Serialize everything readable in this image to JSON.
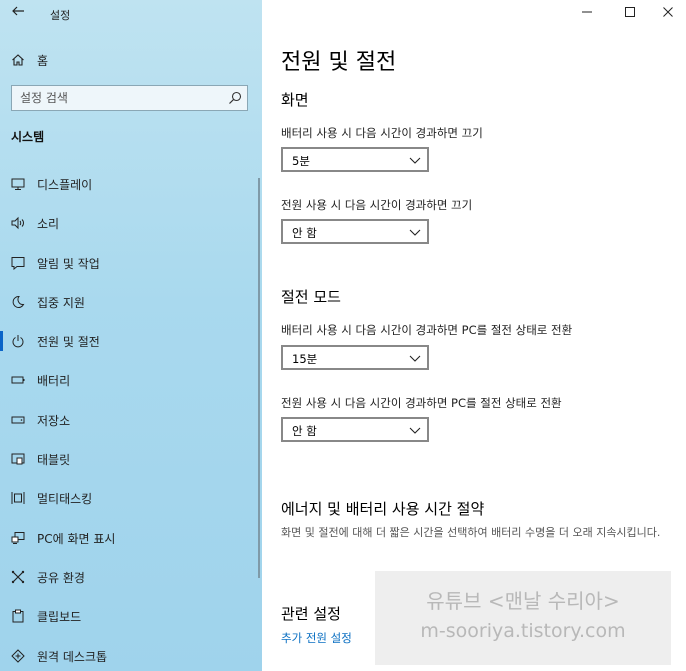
{
  "app": {
    "title": "설정"
  },
  "sidebar": {
    "home_label": "홈",
    "search_placeholder": "설정 검색",
    "section_heading": "시스템",
    "items": [
      {
        "label": "디스플레이",
        "icon": "monitor-icon"
      },
      {
        "label": "소리",
        "icon": "speaker-icon"
      },
      {
        "label": "알림 및 작업",
        "icon": "notification-icon"
      },
      {
        "label": "집중 지원",
        "icon": "moon-icon"
      },
      {
        "label": "전원 및 절전",
        "icon": "power-icon",
        "active": true
      },
      {
        "label": "배터리",
        "icon": "battery-icon"
      },
      {
        "label": "저장소",
        "icon": "storage-icon"
      },
      {
        "label": "태블릿",
        "icon": "tablet-icon"
      },
      {
        "label": "멀티태스킹",
        "icon": "multitasking-icon"
      },
      {
        "label": "PC에 화면 표시",
        "icon": "project-icon"
      },
      {
        "label": "공유 환경",
        "icon": "share-icon"
      },
      {
        "label": "클립보드",
        "icon": "clipboard-icon"
      },
      {
        "label": "원격 데스크톱",
        "icon": "remote-desktop-icon"
      }
    ]
  },
  "main": {
    "page_title": "전원 및 절전",
    "screen_section": {
      "heading": "화면",
      "battery_label": "배터리 사용 시 다음 시간이 경과하면 끄기",
      "battery_value": "5분",
      "plugged_label": "전원 사용 시 다음 시간이 경과하면 끄기",
      "plugged_value": "안 함"
    },
    "sleep_section": {
      "heading": "절전 모드",
      "battery_label": "배터리 사용 시 다음 시간이 경과하면 PC를 절전 상태로 전환",
      "battery_value": "15분",
      "plugged_label": "전원 사용 시 다음 시간이 경과하면 PC를 절전 상태로 전환",
      "plugged_value": "안 함"
    },
    "energy_section": {
      "heading": "에너지 및 배터리 사용 시간 절약",
      "description": "화면 및 절전에 대해 더 짧은 시간을 선택하여 배터리 수명을 더 오래 지속시킵니다."
    },
    "related_section": {
      "heading": "관련 설정",
      "link": "추가 전원 설정"
    }
  },
  "watermark": {
    "line1": "유튜브 <맨날 수리아>",
    "line2": "m-sooriya.tistory.com"
  }
}
